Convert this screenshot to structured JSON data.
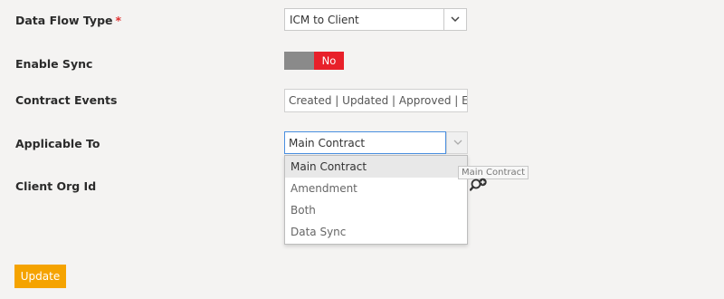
{
  "form": {
    "data_flow_type": {
      "label": "Data Flow Type",
      "required_mark": "*",
      "value": "ICM to Client"
    },
    "enable_sync": {
      "label": "Enable Sync",
      "state": "No"
    },
    "contract_events": {
      "label": "Contract Events",
      "value": "Created | Updated | Approved | Executed"
    },
    "applicable_to": {
      "label": "Applicable To",
      "value": "Main Contract",
      "options": [
        "Main Contract",
        "Amendment",
        "Both",
        "Data Sync"
      ],
      "tooltip": "Main Contract"
    },
    "client_org_id": {
      "label": "Client Org Id"
    },
    "update_label": "Update"
  },
  "icons": {
    "select_chevron": "chevron-down-icon",
    "combo_chevron": "chevron-down-icon",
    "lookup": "search-plus-icon"
  },
  "colors": {
    "toggle_off": "#e8202a",
    "toggle_knob": "#8a8a8a",
    "update_button": "#f5a300",
    "focus_border": "#4a8fe0",
    "required": "#e03030"
  }
}
